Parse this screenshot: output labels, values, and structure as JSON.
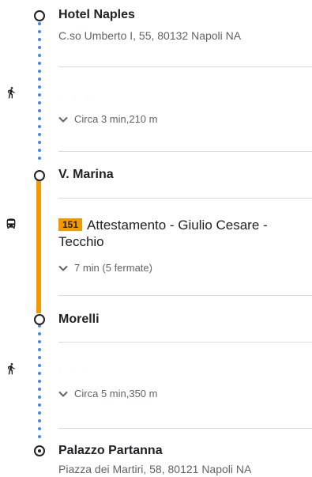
{
  "start": {
    "title": "Hotel Naples",
    "address": "C.so Umberto I, 55, 80132 Napoli NA"
  },
  "walk1": {
    "summary": "Circa 3 min,210 m",
    "icon": "walk-icon"
  },
  "stop1": {
    "title": "V. Marina"
  },
  "bus": {
    "icon": "bus-icon",
    "line": "151",
    "line_color": "#f29900",
    "route": "Attestamento - Giulio Cesare - Tecchio",
    "summary": "7 min (5 fermate)"
  },
  "stop2": {
    "title": "Morelli"
  },
  "walk2": {
    "summary": "Circa 5 min,350 m",
    "icon": "walk-icon"
  },
  "destination": {
    "title": "Palazzo Partanna",
    "address": "Piazza dei Martiri, 58, 80121 Napoli NA"
  },
  "colors": {
    "walk_dots": "#4285f4",
    "bus_line": "#f29900",
    "text_primary": "#202124",
    "text_secondary": "#5f6368",
    "divider": "#dadce0"
  }
}
